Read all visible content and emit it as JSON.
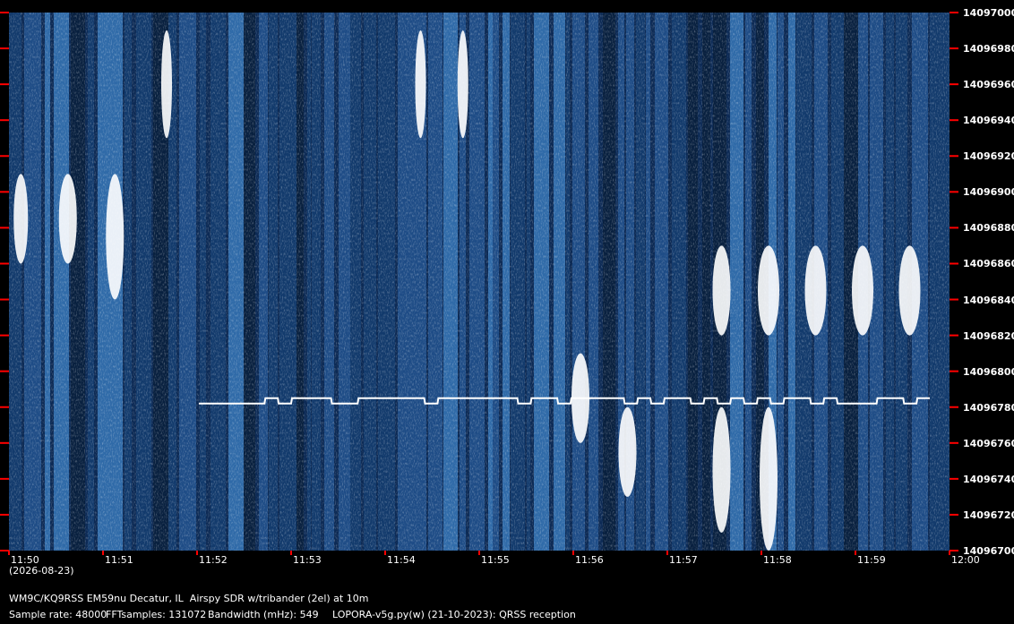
{
  "chart_data": {
    "type": "heatmap",
    "title": "",
    "xlabel": "",
    "ylabel": "",
    "x_tick_labels": [
      "11:50",
      "11:51",
      "11:52",
      "11:53",
      "11:54",
      "11:55",
      "11:56",
      "11:57",
      "11:58",
      "11:59",
      "12:00"
    ],
    "x_range": [
      "11:50",
      "12:00"
    ],
    "date_label": "(2026-08-23)",
    "y_tick_labels": [
      "14097000",
      "14096980",
      "14096960",
      "14096940",
      "14096920",
      "14096900",
      "14096880",
      "14096860",
      "14096840",
      "14096820",
      "14096800",
      "14096780",
      "14096760",
      "14096740",
      "14096720",
      "14096700"
    ],
    "y_range": [
      14096700,
      14097000
    ],
    "signal_trace": {
      "description_hz": 14096782,
      "start_time": "11:52",
      "end_time": "11:59:50"
    },
    "colors": {
      "background": "#0c2a55",
      "signal": "#ffffff",
      "tick": "#ff0000"
    }
  },
  "footer": {
    "station": "WM9C/KQ9RSS EM59nu Decatur, IL  Airspy SDR w/tribander (2el) at 10m",
    "sample_rate": "Sample rate: 48000",
    "fft_samples": "FFTsamples: 131072",
    "bandwidth": "Bandwidth (mHz): 549",
    "software": "LOPORA-v5g.py(w) (21-10-2023): QRSS reception"
  }
}
